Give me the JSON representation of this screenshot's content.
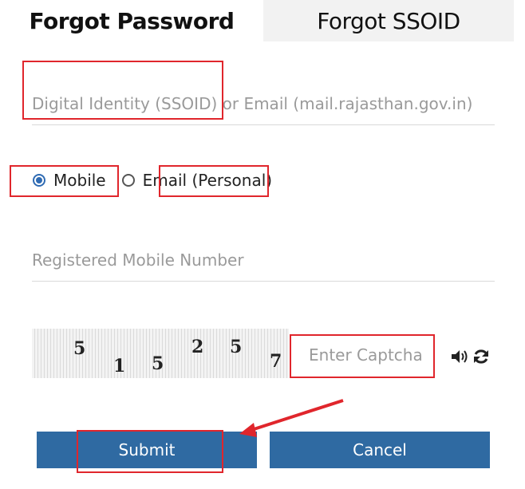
{
  "tabs": {
    "forgot_password": "Forgot Password",
    "forgot_ssoid": "Forgot SSOID"
  },
  "form": {
    "ssoid_placeholder": "Digital Identity (SSOID) or Email (mail.rajasthan.gov.in)",
    "radio_mobile_label": "Mobile",
    "radio_email_label": "Email (Personal)",
    "selected_option": "Mobile",
    "mobile_placeholder": "Registered Mobile Number",
    "captcha_digits": [
      "5",
      "1",
      "5",
      "2",
      "5",
      "7"
    ],
    "captcha_placeholder": "Enter Captcha",
    "submit_label": "Submit",
    "cancel_label": "Cancel"
  },
  "icons": {
    "audio": "speaker-icon",
    "refresh": "refresh-icon",
    "radio_checked": "radio-checked-icon",
    "radio_unchecked": "radio-unchecked-icon"
  },
  "colors": {
    "primary_button": "#2f6aa2",
    "annotation_red": "#e0262c",
    "radio_accent": "#2f6bb3"
  }
}
